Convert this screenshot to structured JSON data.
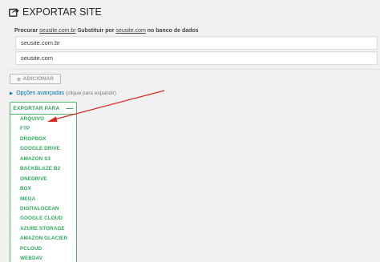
{
  "header": {
    "title": "EXPORTAR SITE",
    "icon": "share-export-icon"
  },
  "search_replace": {
    "label_prefix": "Procurar",
    "search_term": "seusite.com.br",
    "label_middle": "Substituir por",
    "replace_term": "seusite.com",
    "label_suffix": "no banco de dados",
    "find_value": "seusite.com.br",
    "replace_value": "seusite.com"
  },
  "add_button": {
    "icon": "plus-circle-icon",
    "label": "ADICIONAR"
  },
  "advanced": {
    "toggle_icon": "triangle-right-icon",
    "link": "Opções avançadas",
    "hint": "(clique para expandir)"
  },
  "export": {
    "header": "EXPORTAR PARA",
    "collapse_symbol": "—",
    "destinations": [
      "ARQUIVO",
      "FTP",
      "DROPBOX",
      "GOOGLE DRIVE",
      "AMAZON S3",
      "BACKBLAZE B2",
      "ONEDRIVE",
      "BOX",
      "MEGA",
      "DIGITALOCEAN",
      "GOOGLE CLOUD",
      "AZURE STORAGE",
      "AMAZON GLACIER",
      "PCLOUD",
      "WEBDAV"
    ]
  },
  "colors": {
    "accent_green": "#2eab5b",
    "link_blue": "#0073aa",
    "annotation_red": "#d9261c"
  }
}
